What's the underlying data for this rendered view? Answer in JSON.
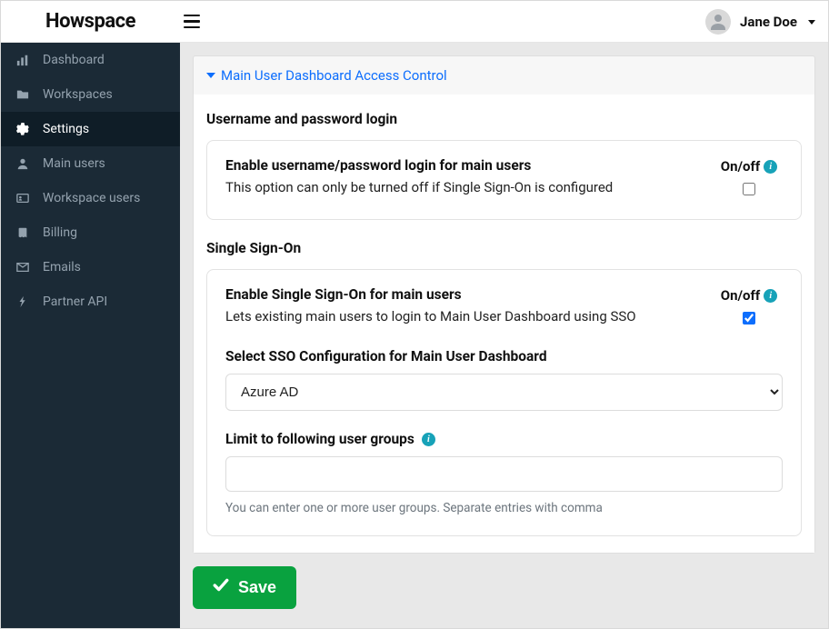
{
  "brand": "Howspace",
  "user": {
    "name": "Jane Doe"
  },
  "sidebar": {
    "items": [
      {
        "label": "Dashboard"
      },
      {
        "label": "Workspaces"
      },
      {
        "label": "Settings"
      },
      {
        "label": "Main users"
      },
      {
        "label": "Workspace users"
      },
      {
        "label": "Billing"
      },
      {
        "label": "Emails"
      },
      {
        "label": "Partner API"
      }
    ]
  },
  "panel": {
    "title": "Main User Dashboard Access Control"
  },
  "section_username": {
    "title": "Username and password login",
    "field_label": "Enable username/password login for main users",
    "field_desc": "This option can only be turned off if Single Sign-On is configured",
    "onoff": "On/off",
    "checked": false
  },
  "section_sso": {
    "title": "Single Sign-On",
    "field_label": "Enable Single Sign-On for main users",
    "field_desc": "Lets existing main users to login to Main User Dashboard using SSO",
    "onoff": "On/off",
    "checked": true,
    "select_label": "Select SSO Configuration for Main User Dashboard",
    "select_value": "Azure AD",
    "groups_label": "Limit to following user groups",
    "groups_value": "",
    "groups_hint": "You can enter one or more user groups. Separate entries with comma"
  },
  "buttons": {
    "save": "Save"
  }
}
